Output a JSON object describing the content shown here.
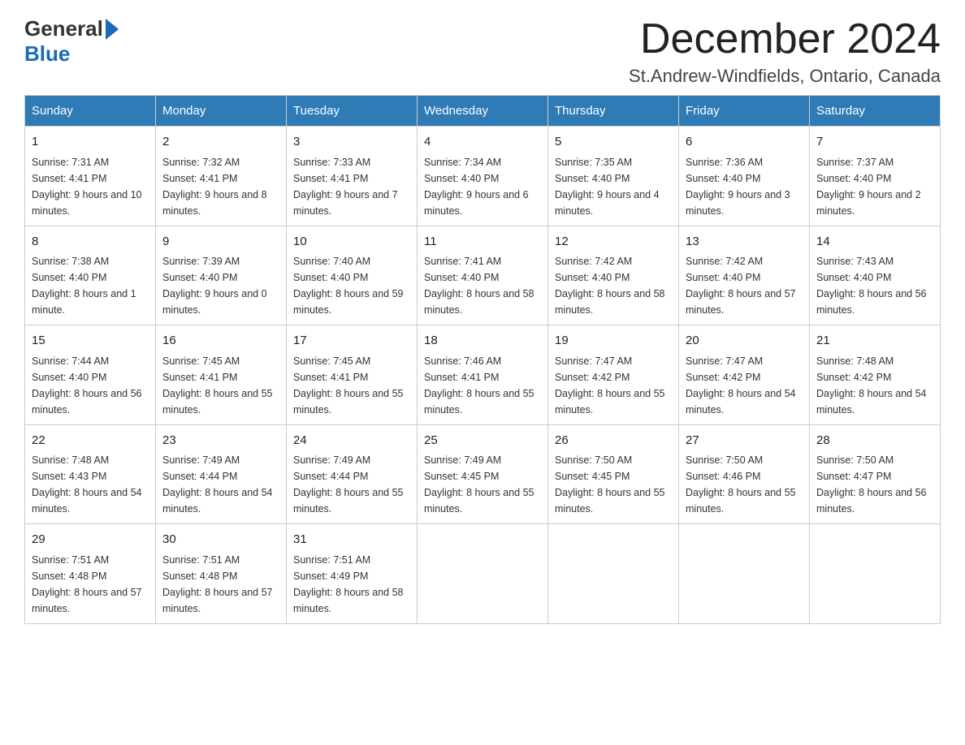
{
  "header": {
    "logo_general": "General",
    "logo_blue": "Blue",
    "month_title": "December 2024",
    "location": "St.Andrew-Windfields, Ontario, Canada"
  },
  "weekdays": [
    "Sunday",
    "Monday",
    "Tuesday",
    "Wednesday",
    "Thursday",
    "Friday",
    "Saturday"
  ],
  "weeks": [
    [
      {
        "day": "1",
        "sunrise": "7:31 AM",
        "sunset": "4:41 PM",
        "daylight": "9 hours and 10 minutes."
      },
      {
        "day": "2",
        "sunrise": "7:32 AM",
        "sunset": "4:41 PM",
        "daylight": "9 hours and 8 minutes."
      },
      {
        "day": "3",
        "sunrise": "7:33 AM",
        "sunset": "4:41 PM",
        "daylight": "9 hours and 7 minutes."
      },
      {
        "day": "4",
        "sunrise": "7:34 AM",
        "sunset": "4:40 PM",
        "daylight": "9 hours and 6 minutes."
      },
      {
        "day": "5",
        "sunrise": "7:35 AM",
        "sunset": "4:40 PM",
        "daylight": "9 hours and 4 minutes."
      },
      {
        "day": "6",
        "sunrise": "7:36 AM",
        "sunset": "4:40 PM",
        "daylight": "9 hours and 3 minutes."
      },
      {
        "day": "7",
        "sunrise": "7:37 AM",
        "sunset": "4:40 PM",
        "daylight": "9 hours and 2 minutes."
      }
    ],
    [
      {
        "day": "8",
        "sunrise": "7:38 AM",
        "sunset": "4:40 PM",
        "daylight": "8 hours and 1 minute."
      },
      {
        "day": "9",
        "sunrise": "7:39 AM",
        "sunset": "4:40 PM",
        "daylight": "9 hours and 0 minutes."
      },
      {
        "day": "10",
        "sunrise": "7:40 AM",
        "sunset": "4:40 PM",
        "daylight": "8 hours and 59 minutes."
      },
      {
        "day": "11",
        "sunrise": "7:41 AM",
        "sunset": "4:40 PM",
        "daylight": "8 hours and 58 minutes."
      },
      {
        "day": "12",
        "sunrise": "7:42 AM",
        "sunset": "4:40 PM",
        "daylight": "8 hours and 58 minutes."
      },
      {
        "day": "13",
        "sunrise": "7:42 AM",
        "sunset": "4:40 PM",
        "daylight": "8 hours and 57 minutes."
      },
      {
        "day": "14",
        "sunrise": "7:43 AM",
        "sunset": "4:40 PM",
        "daylight": "8 hours and 56 minutes."
      }
    ],
    [
      {
        "day": "15",
        "sunrise": "7:44 AM",
        "sunset": "4:40 PM",
        "daylight": "8 hours and 56 minutes."
      },
      {
        "day": "16",
        "sunrise": "7:45 AM",
        "sunset": "4:41 PM",
        "daylight": "8 hours and 55 minutes."
      },
      {
        "day": "17",
        "sunrise": "7:45 AM",
        "sunset": "4:41 PM",
        "daylight": "8 hours and 55 minutes."
      },
      {
        "day": "18",
        "sunrise": "7:46 AM",
        "sunset": "4:41 PM",
        "daylight": "8 hours and 55 minutes."
      },
      {
        "day": "19",
        "sunrise": "7:47 AM",
        "sunset": "4:42 PM",
        "daylight": "8 hours and 55 minutes."
      },
      {
        "day": "20",
        "sunrise": "7:47 AM",
        "sunset": "4:42 PM",
        "daylight": "8 hours and 54 minutes."
      },
      {
        "day": "21",
        "sunrise": "7:48 AM",
        "sunset": "4:42 PM",
        "daylight": "8 hours and 54 minutes."
      }
    ],
    [
      {
        "day": "22",
        "sunrise": "7:48 AM",
        "sunset": "4:43 PM",
        "daylight": "8 hours and 54 minutes."
      },
      {
        "day": "23",
        "sunrise": "7:49 AM",
        "sunset": "4:44 PM",
        "daylight": "8 hours and 54 minutes."
      },
      {
        "day": "24",
        "sunrise": "7:49 AM",
        "sunset": "4:44 PM",
        "daylight": "8 hours and 55 minutes."
      },
      {
        "day": "25",
        "sunrise": "7:49 AM",
        "sunset": "4:45 PM",
        "daylight": "8 hours and 55 minutes."
      },
      {
        "day": "26",
        "sunrise": "7:50 AM",
        "sunset": "4:45 PM",
        "daylight": "8 hours and 55 minutes."
      },
      {
        "day": "27",
        "sunrise": "7:50 AM",
        "sunset": "4:46 PM",
        "daylight": "8 hours and 55 minutes."
      },
      {
        "day": "28",
        "sunrise": "7:50 AM",
        "sunset": "4:47 PM",
        "daylight": "8 hours and 56 minutes."
      }
    ],
    [
      {
        "day": "29",
        "sunrise": "7:51 AM",
        "sunset": "4:48 PM",
        "daylight": "8 hours and 57 minutes."
      },
      {
        "day": "30",
        "sunrise": "7:51 AM",
        "sunset": "4:48 PM",
        "daylight": "8 hours and 57 minutes."
      },
      {
        "day": "31",
        "sunrise": "7:51 AM",
        "sunset": "4:49 PM",
        "daylight": "8 hours and 58 minutes."
      },
      null,
      null,
      null,
      null
    ]
  ]
}
